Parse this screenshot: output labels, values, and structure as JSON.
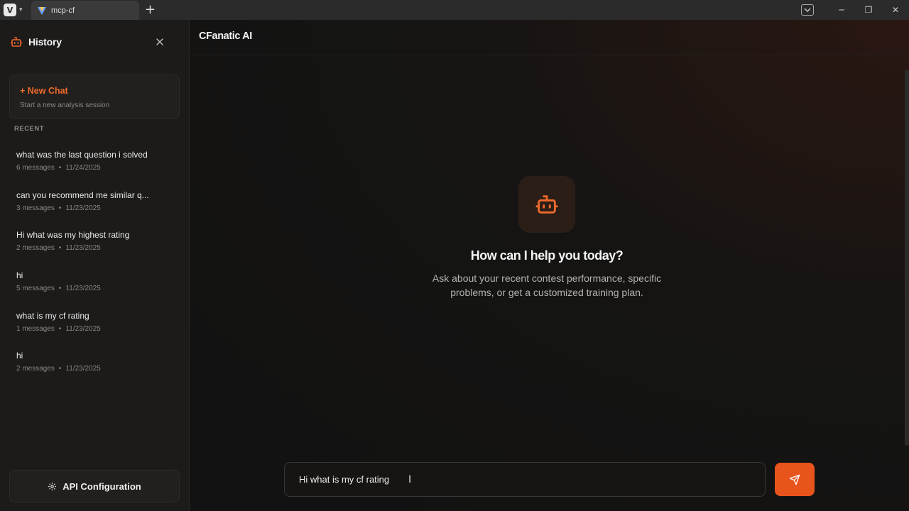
{
  "browser": {
    "tab_title": "mcp-cf",
    "new_tab_glyph": "+",
    "window_controls": [
      "─",
      "❐",
      "✕"
    ],
    "menu_caret": "▾"
  },
  "sidebar": {
    "title": "History",
    "new_chat": {
      "label": "+ New Chat",
      "subtitle": "Start a new analysis session"
    },
    "recent_label": "RECENT",
    "items": [
      {
        "title": "what was the last question i solved",
        "count": "6 messages",
        "date": "11/24/2025"
      },
      {
        "title": "can you recommend me similar q...",
        "count": "3 messages",
        "date": "11/23/2025"
      },
      {
        "title": "Hi what was my highest rating",
        "count": "2 messages",
        "date": "11/23/2025"
      },
      {
        "title": "hi",
        "count": "5 messages",
        "date": "11/23/2025"
      },
      {
        "title": "what is my cf rating",
        "count": "1 messages",
        "date": "11/23/2025"
      },
      {
        "title": "hi",
        "count": "2 messages",
        "date": "11/23/2025"
      }
    ],
    "api_button": "API Configuration"
  },
  "main": {
    "brand": "CFanatic AI",
    "welcome_title": "How can I help you today?",
    "welcome_text": "Ask about your recent contest performance, specific problems, or get a customized training plan.",
    "input_value": "Hi what is my cf rating"
  },
  "colors": {
    "accent": "#ef6a2c",
    "send_button": "#e9541c",
    "sidebar_bg": "#1c1b1a",
    "main_bg": "#121212"
  },
  "icons": {
    "app": "vivaldi-icon",
    "history": "robot-icon",
    "close": "close-icon",
    "settings": "gear-icon",
    "send": "send-icon",
    "bot": "robot-icon"
  }
}
